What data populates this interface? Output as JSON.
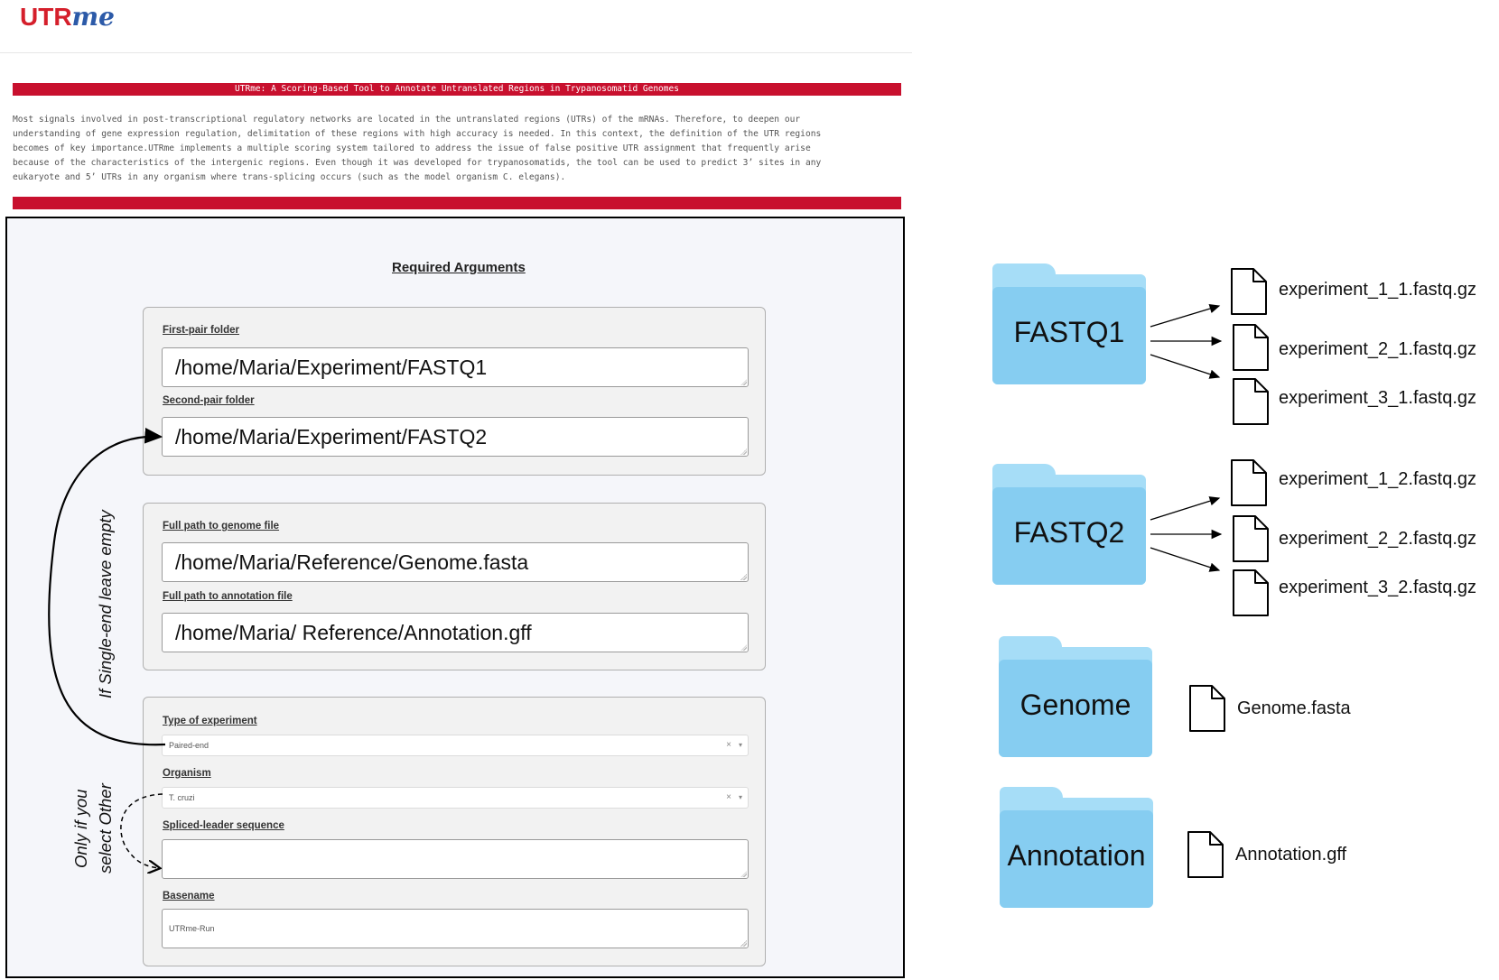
{
  "app": {
    "logo_prefix": "UTR",
    "logo_suffix": "me"
  },
  "banner": {
    "title": "UTRme: A Scoring-Based Tool to Annotate Untranslated Regions in Trypanosomatid Genomes"
  },
  "intro": {
    "lines": [
      "Most signals involved in post-transcriptional regulatory networks are located in the untranslated regions (UTRs) of the mRNAs. Therefore, to deepen our",
      "understanding of gene expression regulation, delimitation of these regions with high accuracy is needed. In this context, the definition of the UTR regions",
      "becomes of key importance.UTRme implements a multiple scoring system tailored to address the issue of false positive UTR assignment that frequently arise",
      "because of the characteristics of the intergenic regions. Even though it was developed for trypanosomatids, the tool can be used to predict 3’ sites in any",
      "eukaryote and 5’ UTRs in any organism where trans-splicing occurs (such as the model organism C. elegans)."
    ]
  },
  "form": {
    "title": "Required Arguments",
    "first_pair": {
      "label": "First-pair folder",
      "value": "/home/Maria/Experiment/FASTQ1"
    },
    "second_pair": {
      "label": "Second-pair folder",
      "value": "/home/Maria/Experiment/FASTQ2"
    },
    "genome": {
      "label": "Full path to genome file",
      "value": "/home/Maria/Reference/Genome.fasta"
    },
    "annotation": {
      "label": "Full path to annotation file",
      "value": "/home/Maria/ Reference/Annotation.gff"
    },
    "experiment_type": {
      "label": "Type of experiment",
      "value": "Paired-end",
      "clear": "×",
      "caret": "▾"
    },
    "organism": {
      "label": "Organism",
      "value": "T. cruzi",
      "clear": "×",
      "caret": "▾"
    },
    "spliced_leader": {
      "label": "Spliced-leader sequence",
      "value": ""
    },
    "basename": {
      "label": "Basename",
      "value": "UTRme-Run"
    }
  },
  "annotations": {
    "single_end": "If Single-end leave empty",
    "other_line1": "Only if you",
    "other_line2": "select Other"
  },
  "folders": [
    {
      "name": "FASTQ1",
      "files": [
        "experiment_1_1.fastq.gz",
        "experiment_2_1.fastq.gz",
        "experiment_3_1.fastq.gz"
      ]
    },
    {
      "name": "FASTQ2",
      "files": [
        "experiment_1_2.fastq.gz",
        "experiment_2_2.fastq.gz",
        "experiment_3_2.fastq.gz"
      ]
    },
    {
      "name": "Genome",
      "files": [
        "Genome.fasta"
      ]
    },
    {
      "name": "Annotation",
      "files": [
        "Annotation.gff"
      ]
    }
  ],
  "colors": {
    "banner": "#c8102e",
    "logo_red": "#d51f2b",
    "logo_blue": "#2c5aa8",
    "folder_front": "#86cdf1",
    "folder_back": "#a6ddf7"
  }
}
